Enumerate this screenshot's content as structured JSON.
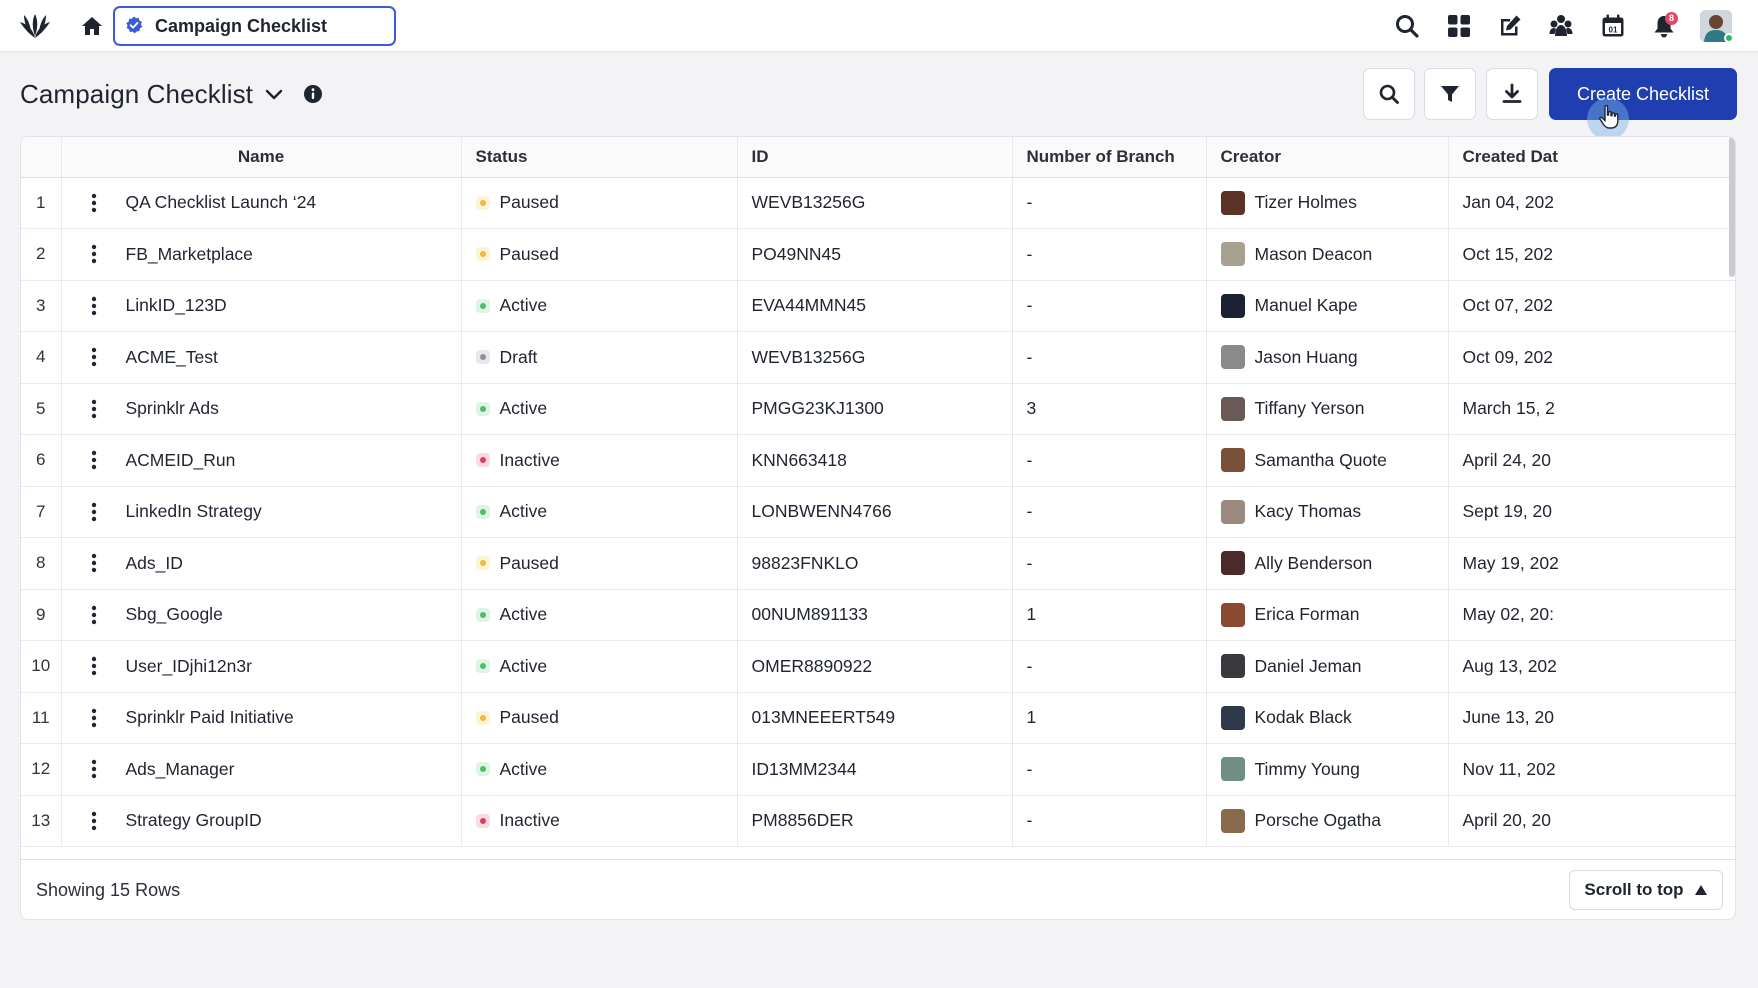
{
  "topbar": {
    "tab_label": "Campaign Checklist",
    "notification_count": "8",
    "icons": [
      "logo-icon",
      "home-icon",
      "search-icon",
      "grid-icon",
      "compose-icon",
      "community-icon",
      "calendar-icon",
      "bell-icon"
    ]
  },
  "header": {
    "title": "Campaign Checklist",
    "create_label": "Create Checklist"
  },
  "table": {
    "columns": [
      "Name",
      "Status",
      "ID",
      "Number of Branch",
      "Creator",
      "Created Dat"
    ],
    "rows": [
      {
        "idx": "1",
        "name": "QA Checklist Launch ‘24",
        "status": "Paused",
        "status_key": "paused",
        "id": "WEVB13256G",
        "branches": "-",
        "creator": "Tizer Holmes",
        "avatar_color": "#5b3324",
        "created": "Jan 04, 202"
      },
      {
        "idx": "2",
        "name": "FB_Marketplace",
        "status": "Paused",
        "status_key": "paused",
        "id": "PO49NN45",
        "branches": "-",
        "creator": "Mason Deacon",
        "avatar_color": "#a8a190",
        "created": "Oct 15, 202"
      },
      {
        "idx": "3",
        "name": "LinkID_123D",
        "status": "Active",
        "status_key": "active",
        "id": "EVA44MMN45",
        "branches": "-",
        "creator": "Manuel Kape",
        "avatar_color": "#1d2233",
        "created": "Oct 07, 202"
      },
      {
        "idx": "4",
        "name": "ACME_Test",
        "status": "Draft",
        "status_key": "draft",
        "id": "WEVB13256G",
        "branches": "-",
        "creator": "Jason Huang",
        "avatar_color": "#8c8a88",
        "created": "Oct 09, 202"
      },
      {
        "idx": "5",
        "name": "Sprinklr Ads",
        "status": "Active",
        "status_key": "active",
        "id": "PMGG23KJ1300",
        "branches": "3",
        "creator": "Tiffany Yerson",
        "avatar_color": "#6a5a55",
        "created": "March 15, 2"
      },
      {
        "idx": "6",
        "name": "ACMEID_Run",
        "status": "Inactive",
        "status_key": "inactive",
        "id": "KNN663418",
        "branches": "-",
        "creator": "Samantha Quote",
        "avatar_color": "#7a5138",
        "created": "April 24, 20"
      },
      {
        "idx": "7",
        "name": "LinkedIn Strategy",
        "status": "Active",
        "status_key": "active",
        "id": "LONBWENN4766",
        "branches": "-",
        "creator": "Kacy Thomas",
        "avatar_color": "#9c8a80",
        "created": "Sept 19, 20"
      },
      {
        "idx": "8",
        "name": "Ads_ID",
        "status": "Paused",
        "status_key": "paused",
        "id": "98823FNKLO",
        "branches": "-",
        "creator": "Ally Benderson",
        "avatar_color": "#4a2a2a",
        "created": "May 19, 202"
      },
      {
        "idx": "9",
        "name": "Sbg_Google",
        "status": "Active",
        "status_key": "active",
        "id": "00NUM891133",
        "branches": "1",
        "creator": "Erica Forman",
        "avatar_color": "#8a4a30",
        "created": "May 02, 20:"
      },
      {
        "idx": "10",
        "name": "User_IDjhi12n3r",
        "status": "Active",
        "status_key": "active",
        "id": "OMER8890922",
        "branches": "-",
        "creator": "Daniel Jeman",
        "avatar_color": "#3a3a3e",
        "created": "Aug 13, 202"
      },
      {
        "idx": "11",
        "name": "Sprinklr Paid Initiative",
        "status": "Paused",
        "status_key": "paused",
        "id": "013MNEEERT549",
        "branches": "1",
        "creator": "Kodak Black",
        "avatar_color": "#2e3a4c",
        "created": "June 13, 20"
      },
      {
        "idx": "12",
        "name": "Ads_Manager",
        "status": "Active",
        "status_key": "active",
        "id": "ID13MM2344",
        "branches": "-",
        "creator": "Timmy Young",
        "avatar_color": "#6f8f86",
        "created": "Nov 11, 202"
      },
      {
        "idx": "13",
        "name": "Strategy GroupID",
        "status": "Inactive",
        "status_key": "inactive",
        "id": "PM8856DER",
        "branches": "-",
        "creator": "Porsche Ogatha",
        "avatar_color": "#8a6a4c",
        "created": "April 20, 20"
      }
    ]
  },
  "footer": {
    "rows_text": "Showing 15 Rows",
    "scroll_top_label": "Scroll to top"
  },
  "colors": {
    "accent": "#1f3fb0",
    "tab_border": "#3d5bd9",
    "paused": "#f3b73a",
    "active": "#4cbf6a",
    "draft": "#8c8f99",
    "inactive": "#e03d64"
  }
}
